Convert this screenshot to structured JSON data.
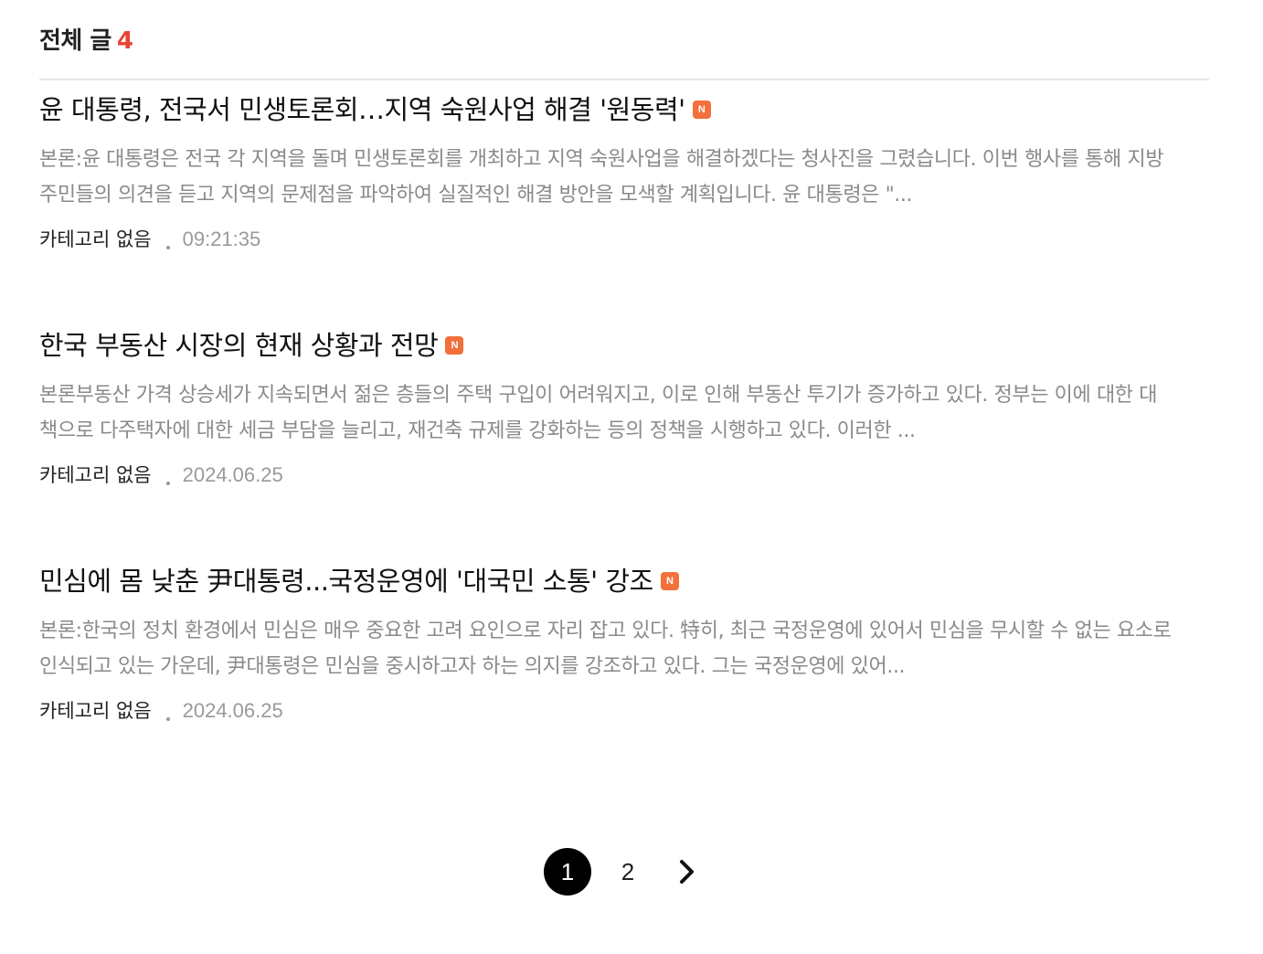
{
  "header": {
    "title": "전체 글",
    "count": "4"
  },
  "posts": [
    {
      "title": "윤 대통령, 전국서 민생토론회…지역 숙원사업 해결 '원동력'",
      "badge": "N",
      "summary": "본론:윤 대통령은 전국 각 지역을 돌며 민생토론회를 개최하고 지역 숙원사업을 해결하겠다는 청사진을 그렸습니다. 이번 행사를 통해 지방 주민들의 의견을 듣고 지역의 문제점을 파악하여 실질적인 해결 방안을 모색할 계획입니다. 윤 대통령은 \"...",
      "category": "카테고리 없음",
      "date": "09:21:35"
    },
    {
      "title": "한국 부동산 시장의 현재 상황과 전망",
      "badge": "N",
      "summary": "본론부동산 가격 상승세가 지속되면서 젊은 층들의 주택 구입이 어려워지고, 이로 인해 부동산 투기가 증가하고 있다. 정부는 이에 대한 대책으로 다주택자에 대한 세금 부담을 늘리고, 재건축 규제를 강화하는 등의 정책을 시행하고 있다. 이러한 ...",
      "category": "카테고리 없음",
      "date": "2024.06.25"
    },
    {
      "title": "민심에 몸 낮춘 尹대통령...국정운영에 '대국민 소통' 강조",
      "badge": "N",
      "summary": "본론:한국의 정치 환경에서 민심은 매우 중요한 고려 요인으로 자리 잡고 있다. 特히, 최근 국정운영에 있어서 민심을 무시할 수 없는 요소로 인식되고 있는 가운데, 尹대통령은 민심을 중시하고자 하는 의지를 강조하고 있다. 그는 국정운영에 있어...",
      "category": "카테고리 없음",
      "date": "2024.06.25"
    }
  ],
  "pagination": {
    "current": "1",
    "next_page": "2",
    "next_icon": "chevron-right-icon"
  },
  "colors": {
    "count_accent": "#e94434",
    "badge": "#f2703b",
    "summary_text": "#8a8a8a",
    "current_page_bg": "#000000"
  }
}
